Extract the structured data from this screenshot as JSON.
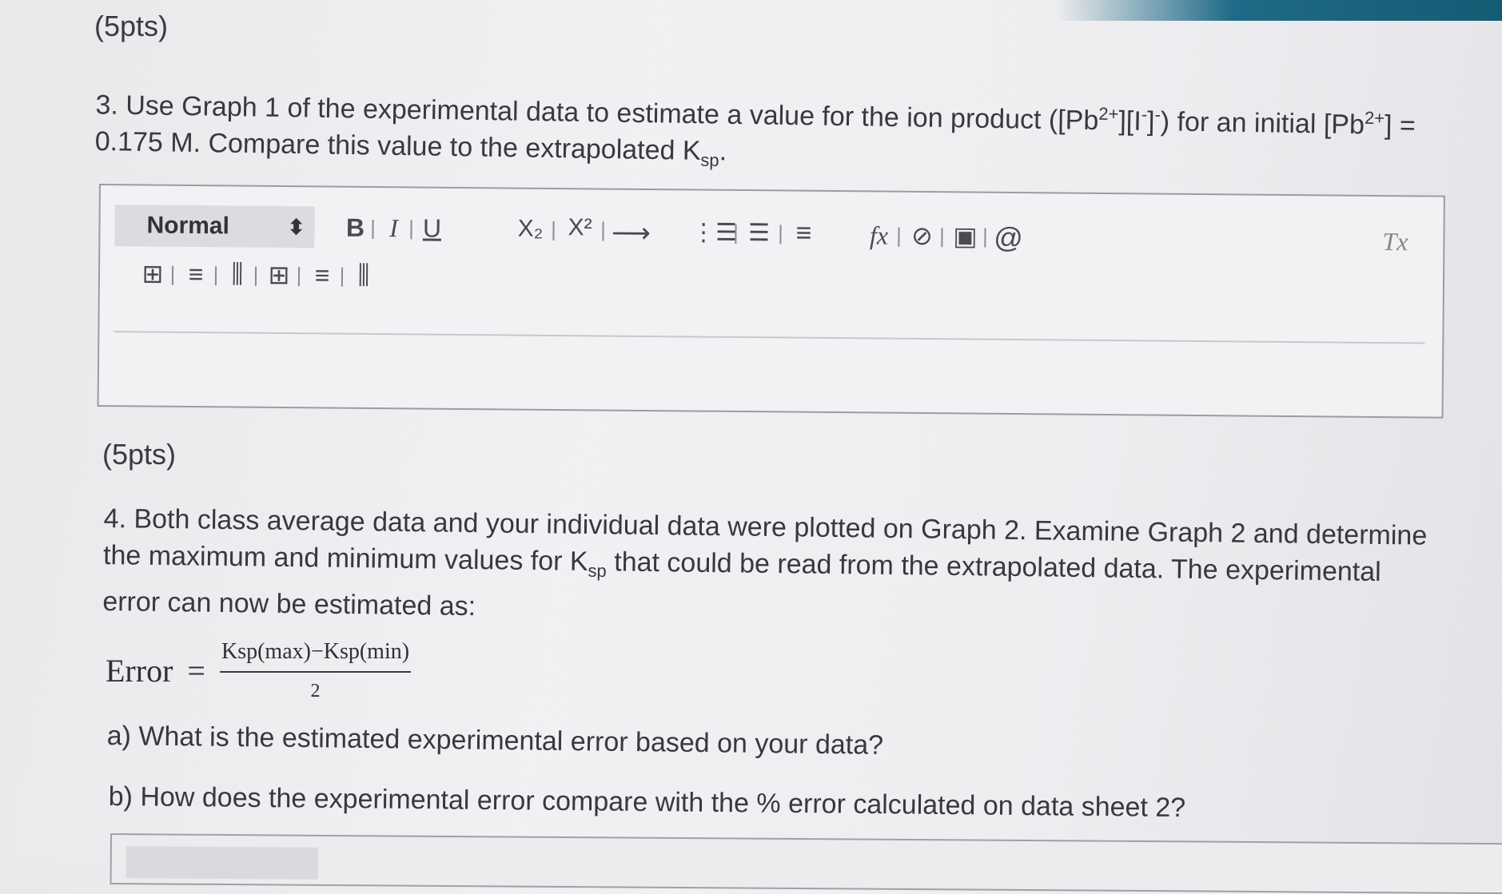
{
  "q3": {
    "points": "(5pts)",
    "line1_a": "3. Use Graph 1 of the experimental data to estimate a value for the ion product ([Pb",
    "sup1": "2+",
    "line1_b": "][I",
    "sup2": "-",
    "line1_c": "]",
    "sup3": "-",
    "line1_d": ") for an initial [Pb",
    "sup4": "2+",
    "line1_e": "] =",
    "line2_a": "0.175 M. Compare this value to the extrapolated K",
    "sub1": "sp",
    "line2_b": "."
  },
  "editor": {
    "format_value": "Normal",
    "format_arrow": "⬍",
    "bold": "B",
    "italic": "I",
    "underline": "U",
    "subscript": "X₂",
    "superscript": "X²",
    "arrow": "⟶",
    "ordered_list": "⋮☰",
    "unordered_list": "☰",
    "align": "≡",
    "formula": "fx",
    "link": "⊘",
    "image": "▣",
    "attach": "@",
    "clear_format": "Tx",
    "table": "⊞",
    "row_insert": "≡",
    "col_insert": "⫼",
    "merge": "⊞",
    "row_delete": "≡",
    "col_delete": "⫼"
  },
  "q4": {
    "points": "(5pts)",
    "line1": "4. Both class average data and your individual data were plotted on Graph 2. Examine Graph 2 and determine",
    "line2_a": "the maximum and minimum values for K",
    "sub1": "sp",
    "line2_b": " that could be read from the extrapolated data. The experimental",
    "line3": "error can now be estimated as:",
    "formula_lhs": "Error",
    "formula_eq": "=",
    "formula_num": "Ksp(max)−Ksp(min)",
    "formula_den": "2",
    "part_a": "a) What is the estimated experimental error based on your data?",
    "part_b": "b) How does the experimental error compare with the % error calculated on data sheet 2?"
  },
  "colors": {
    "accent_bar": "#1f6a86",
    "text": "#38383f"
  }
}
